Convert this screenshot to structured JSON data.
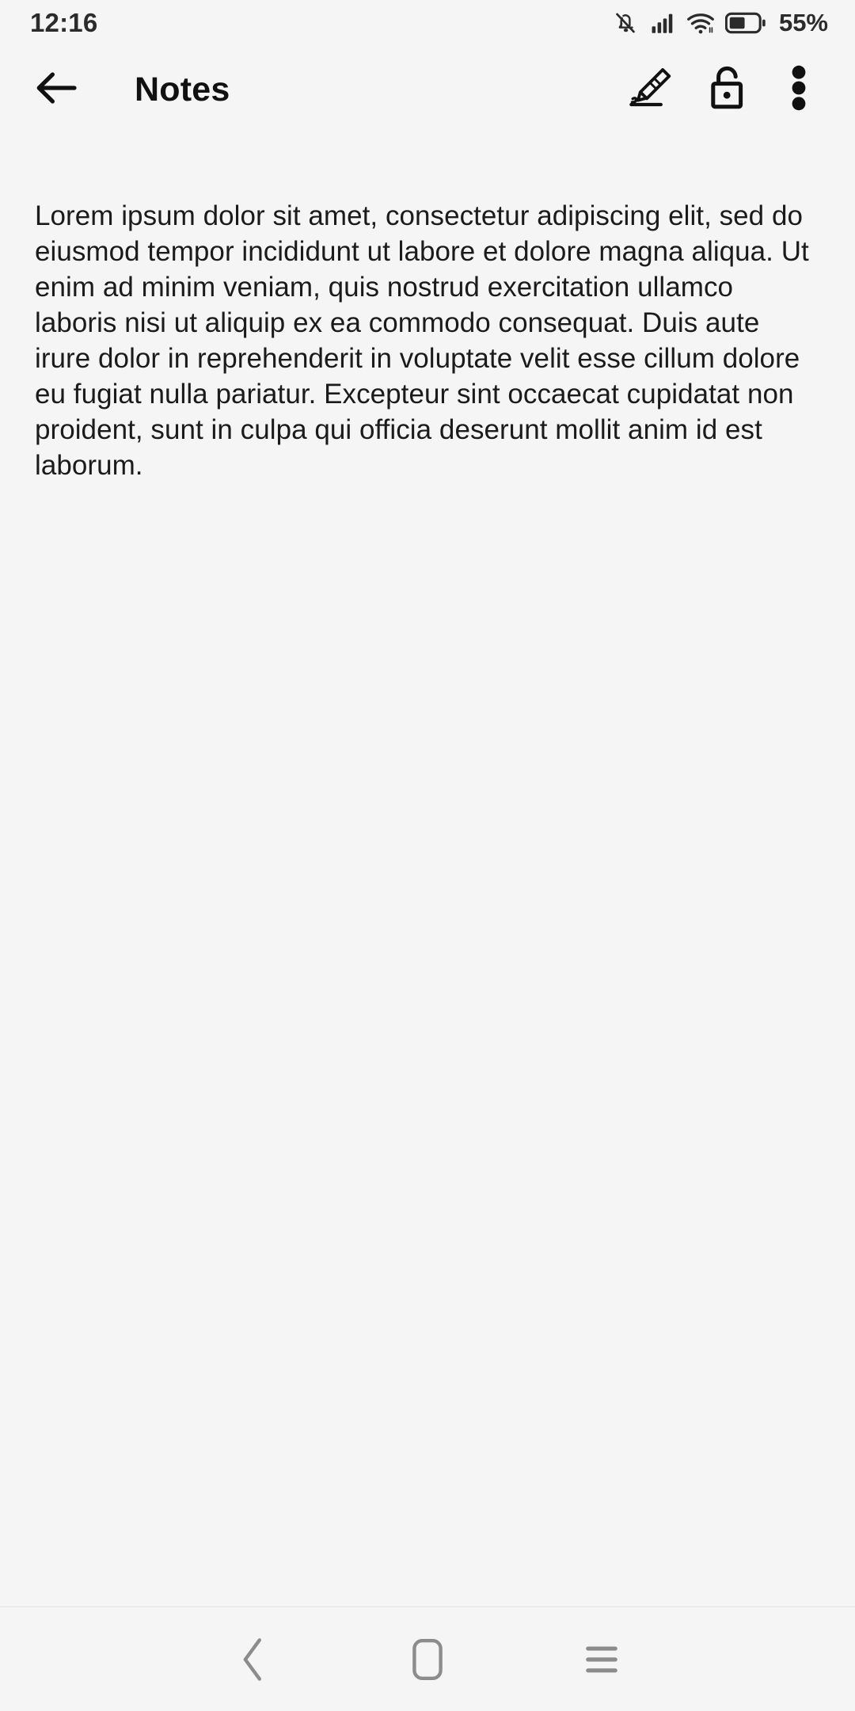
{
  "statusbar": {
    "time": "12:16",
    "battery_percent": "55%",
    "icons": {
      "silent": "bell-slash-icon",
      "signal": "signal-bars-icon",
      "wifi": "wifi-icon",
      "battery": "battery-icon"
    }
  },
  "appbar": {
    "back_label": "back-arrow",
    "title": "Notes",
    "actions": [
      {
        "name": "edit-pencil-icon",
        "label": "Edit"
      },
      {
        "name": "unlock-icon",
        "label": "Unlock"
      },
      {
        "name": "overflow-menu-icon",
        "label": "More options"
      }
    ]
  },
  "note": {
    "body": "Lorem ipsum dolor sit amet, consectetur adipiscing elit, sed do eiusmod tempor incididunt ut labore et dolore magna aliqua. Ut enim ad minim veniam, quis nostrud exercitation ullamco laboris nisi ut aliquip ex ea commodo consequat. Duis aute irure dolor in reprehenderit in voluptate velit esse cillum dolore eu fugiat nulla pariatur. Excepteur sint occaecat cupidatat non proident, sunt in culpa qui officia deserunt mollit anim id est laborum."
  },
  "navbar": {
    "buttons": [
      {
        "name": "nav-back-icon",
        "label": "Back"
      },
      {
        "name": "nav-home-icon",
        "label": "Home"
      },
      {
        "name": "nav-recents-icon",
        "label": "Recents"
      }
    ]
  },
  "colors": {
    "background": "#f5f5f5",
    "text": "#1b1b1b",
    "status_icon": "#2b2b2b",
    "nav_icon": "#8c8c8c",
    "divider": "#e3e3e3"
  }
}
